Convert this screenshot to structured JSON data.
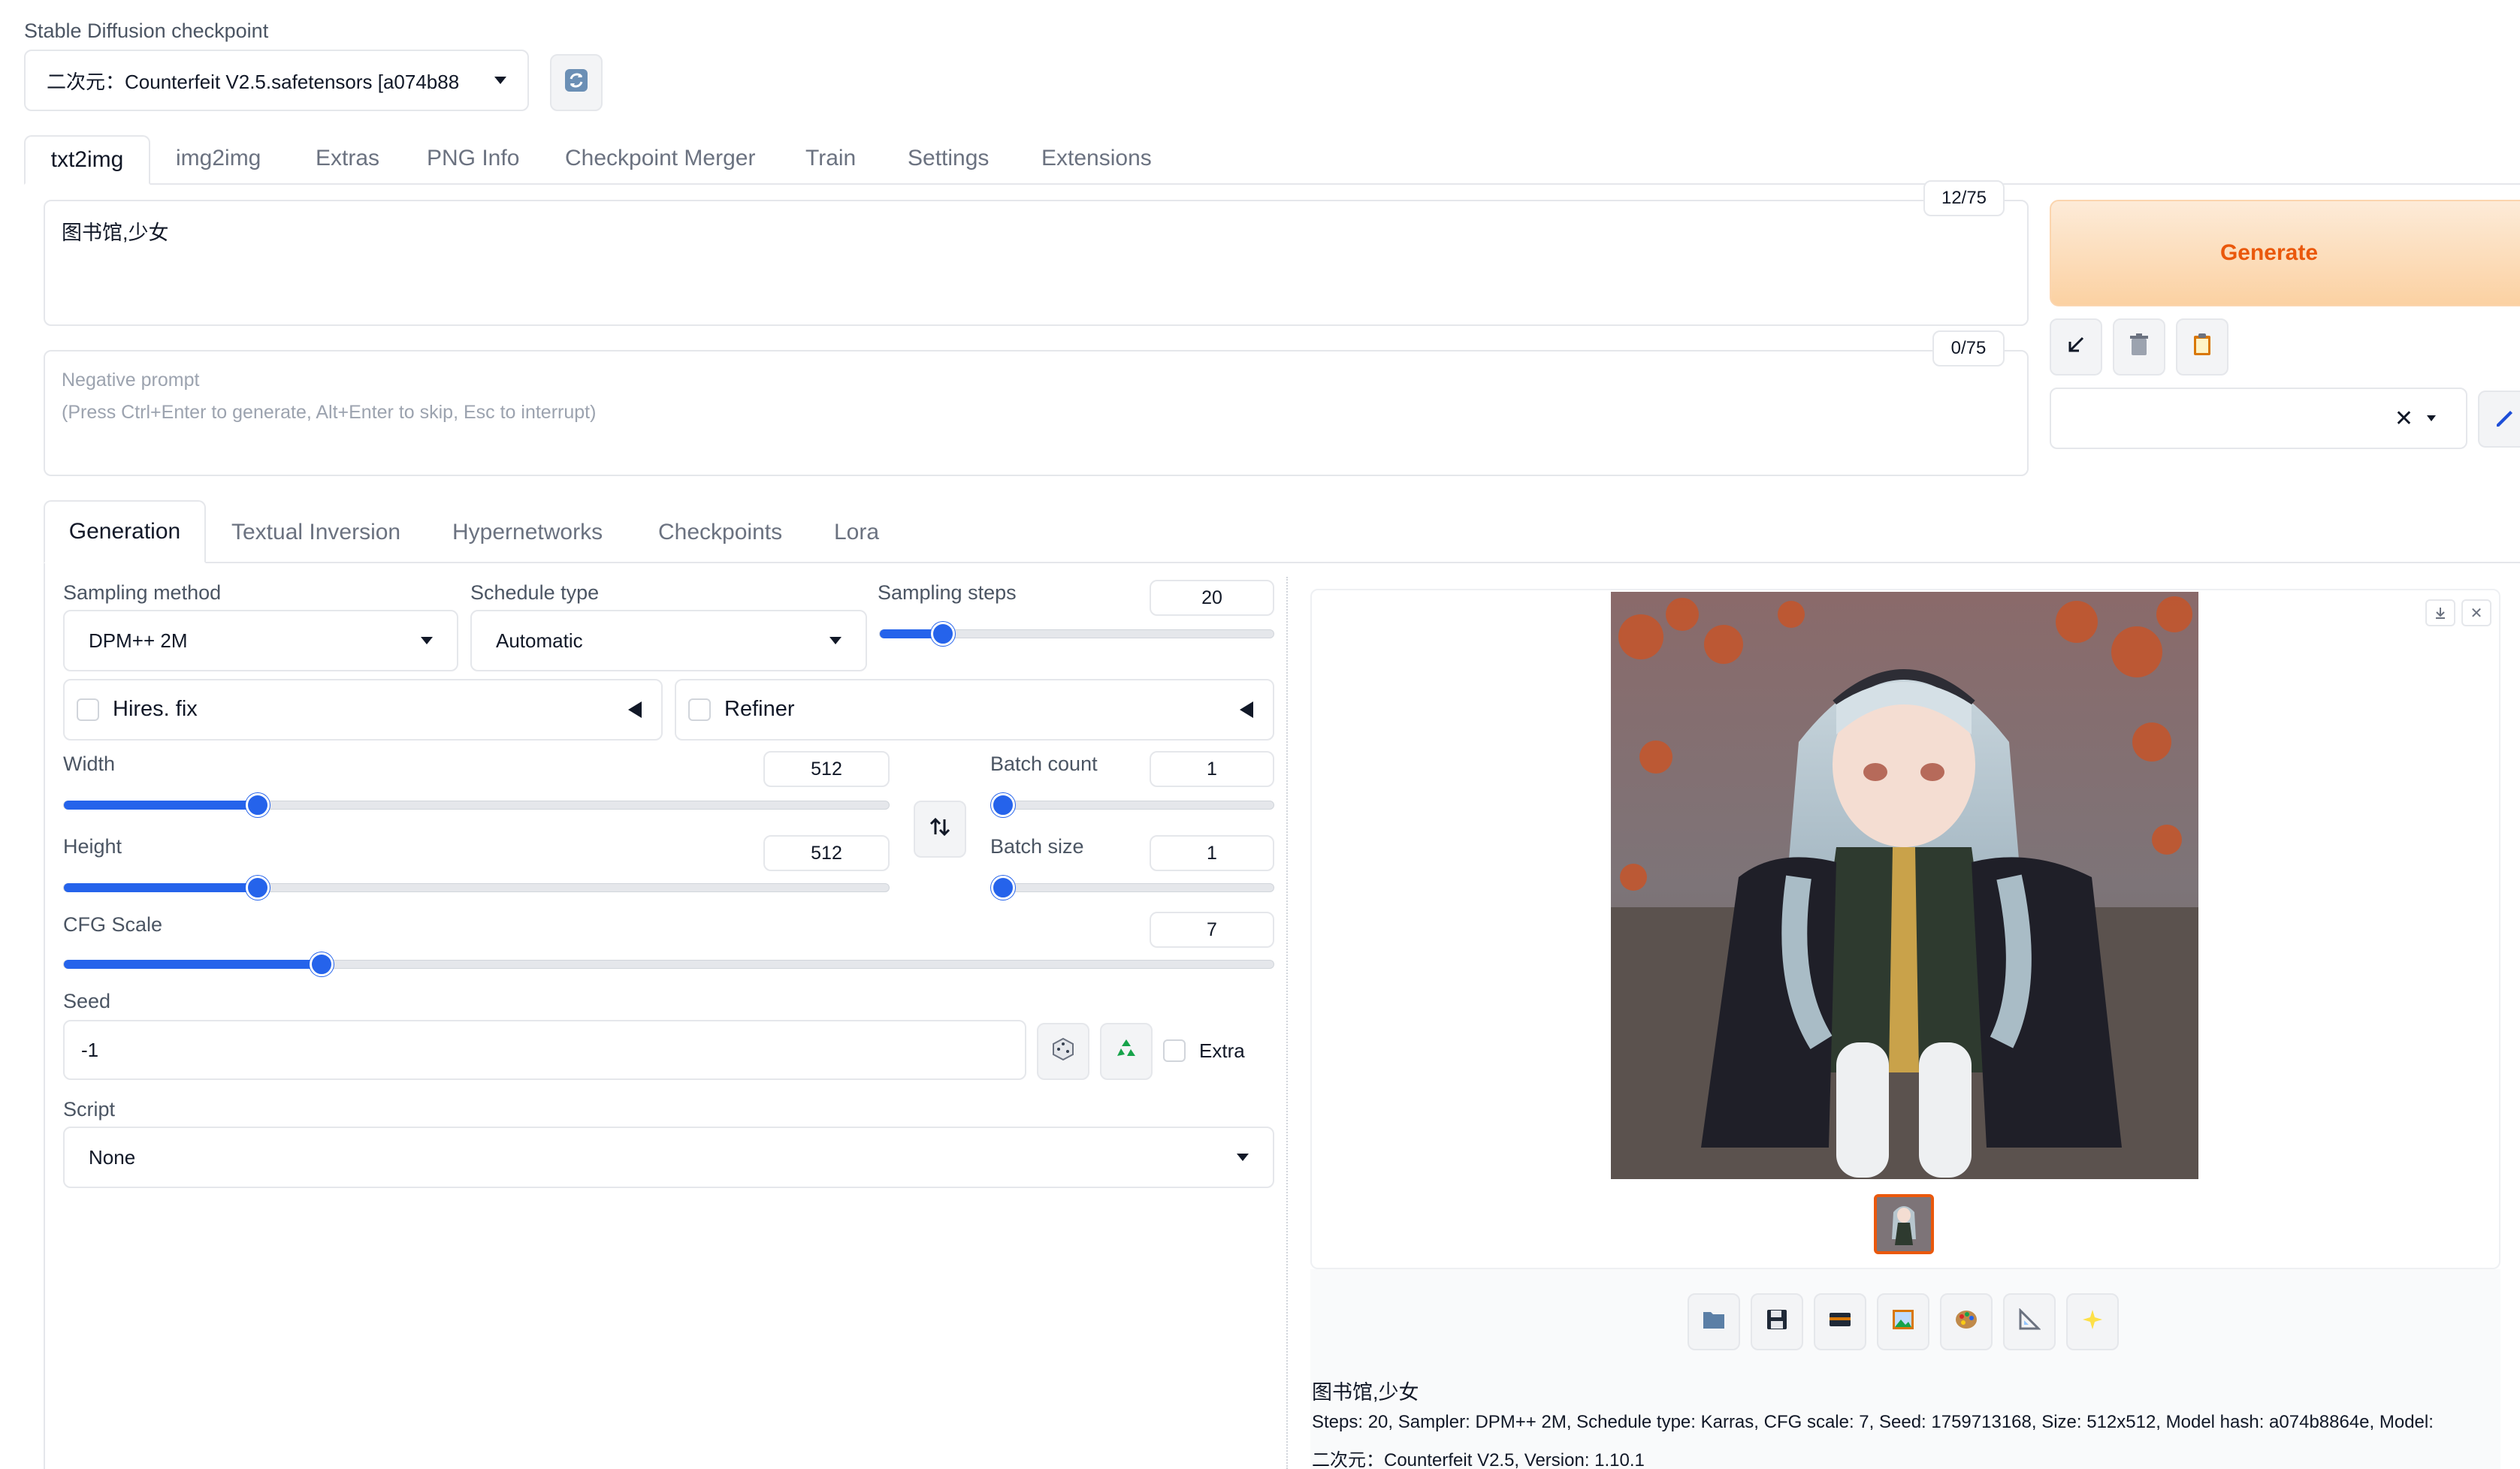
{
  "checkpoint": {
    "label": "Stable Diffusion checkpoint",
    "value": "二次元：Counterfeit V2.5.safetensors [a074b88"
  },
  "main_tabs": [
    "txt2img",
    "img2img",
    "Extras",
    "PNG Info",
    "Checkpoint Merger",
    "Train",
    "Settings",
    "Extensions"
  ],
  "prompt": {
    "value": "图书馆,少女",
    "token_count": "12/75"
  },
  "negative_prompt": {
    "placeholder_line1": "Negative prompt",
    "placeholder_line2": "(Press Ctrl+Enter to generate, Alt+Enter to skip, Esc to interrupt)",
    "token_count": "0/75"
  },
  "generate_label": "Generate",
  "colors": {
    "accent": "#2563eb",
    "generate_text": "#ea580c",
    "generate_bg_from": "#fde7cf",
    "generate_bg_to": "#fcd3a6"
  },
  "sub_tabs": [
    "Generation",
    "Textual Inversion",
    "Hypernetworks",
    "Checkpoints",
    "Lora"
  ],
  "sampling_method": {
    "label": "Sampling method",
    "value": "DPM++ 2M"
  },
  "schedule_type": {
    "label": "Schedule type",
    "value": "Automatic"
  },
  "sampling_steps": {
    "label": "Sampling steps",
    "value": "20",
    "fraction": 0.16
  },
  "hires_fix": {
    "label": "Hires. fix",
    "checked": false
  },
  "refiner": {
    "label": "Refiner",
    "checked": false
  },
  "width": {
    "label": "Width",
    "value": "512",
    "fraction": 0.235
  },
  "height": {
    "label": "Height",
    "value": "512",
    "fraction": 0.235
  },
  "batch_count": {
    "label": "Batch count",
    "value": "1",
    "fraction": 0.0
  },
  "batch_size": {
    "label": "Batch size",
    "value": "1",
    "fraction": 0.0
  },
  "cfg_scale": {
    "label": "CFG Scale",
    "value": "7",
    "fraction": 0.213
  },
  "seed": {
    "label": "Seed",
    "value": "-1",
    "extra_label": "Extra"
  },
  "script": {
    "label": "Script",
    "value": "None"
  },
  "output": {
    "prompt_text": "图书馆,少女",
    "info_line1": "Steps: 20, Sampler: DPM++ 2M, Schedule type: Karras, CFG scale: 7, Seed: 1759713168, Size: 512x512, Model hash: a074b8864e, Model:",
    "info_line2": "二次元：Counterfeit V2.5, Version: 1.10.1"
  },
  "icons": {
    "refresh": "refresh-icon",
    "read_params": "arrow-down-left-icon",
    "trash": "trash-icon",
    "clipboard": "clipboard-icon",
    "clear": "close-icon",
    "edit": "pencil-icon",
    "swap": "swap-vertical-icon",
    "dice": "dice-icon",
    "recycle": "recycle-icon",
    "download": "download-icon",
    "close": "close-icon",
    "folder": "folder-icon",
    "save": "save-icon",
    "zip": "zip-icon",
    "image": "image-icon",
    "palette": "palette-icon",
    "ruler": "ruler-icon",
    "sparkle": "sparkle-icon"
  }
}
